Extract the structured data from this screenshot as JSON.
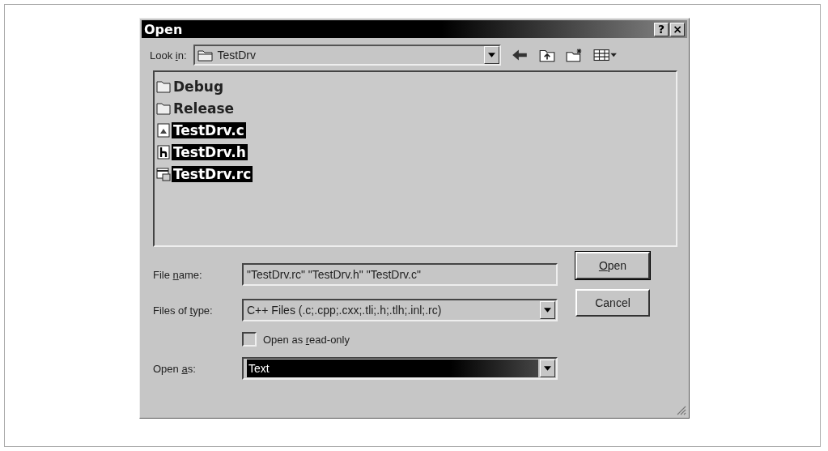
{
  "window": {
    "title": "Open",
    "help_button": "?",
    "close_button": "×"
  },
  "look_in": {
    "label": {
      "pre": "Look ",
      "key": "i",
      "post": "n:"
    },
    "value": "TestDrv"
  },
  "files": [
    {
      "name": "Debug",
      "kind": "folder",
      "selected": false
    },
    {
      "name": "Release",
      "kind": "folder",
      "selected": false
    },
    {
      "name": "TestDrv.c",
      "kind": "c",
      "selected": true
    },
    {
      "name": "TestDrv.h",
      "kind": "h",
      "selected": true
    },
    {
      "name": "TestDrv.rc",
      "kind": "rc",
      "selected": true
    }
  ],
  "file_name": {
    "label": {
      "pre": "File ",
      "key": "n",
      "post": "ame:"
    },
    "value": "\"TestDrv.rc\" \"TestDrv.h\" \"TestDrv.c\""
  },
  "files_of_type": {
    "label": {
      "pre": "Files of ",
      "key": "t",
      "post": "ype:"
    },
    "value": "C++ Files (.c;.cpp;.cxx;.tli;.h;.tlh;.inl;.rc)"
  },
  "read_only": {
    "label": {
      "pre": "Open as ",
      "key": "r",
      "post": "ead-only"
    },
    "checked": false
  },
  "open_as": {
    "label": {
      "pre": "Open ",
      "key": "a",
      "post": "s:"
    },
    "value": "Text",
    "selected": true
  },
  "buttons": [
    {
      "label": {
        "key": "O",
        "post": "pen"
      },
      "default": true
    },
    {
      "label": {
        "pre": "Cancel"
      },
      "default": false
    }
  ]
}
